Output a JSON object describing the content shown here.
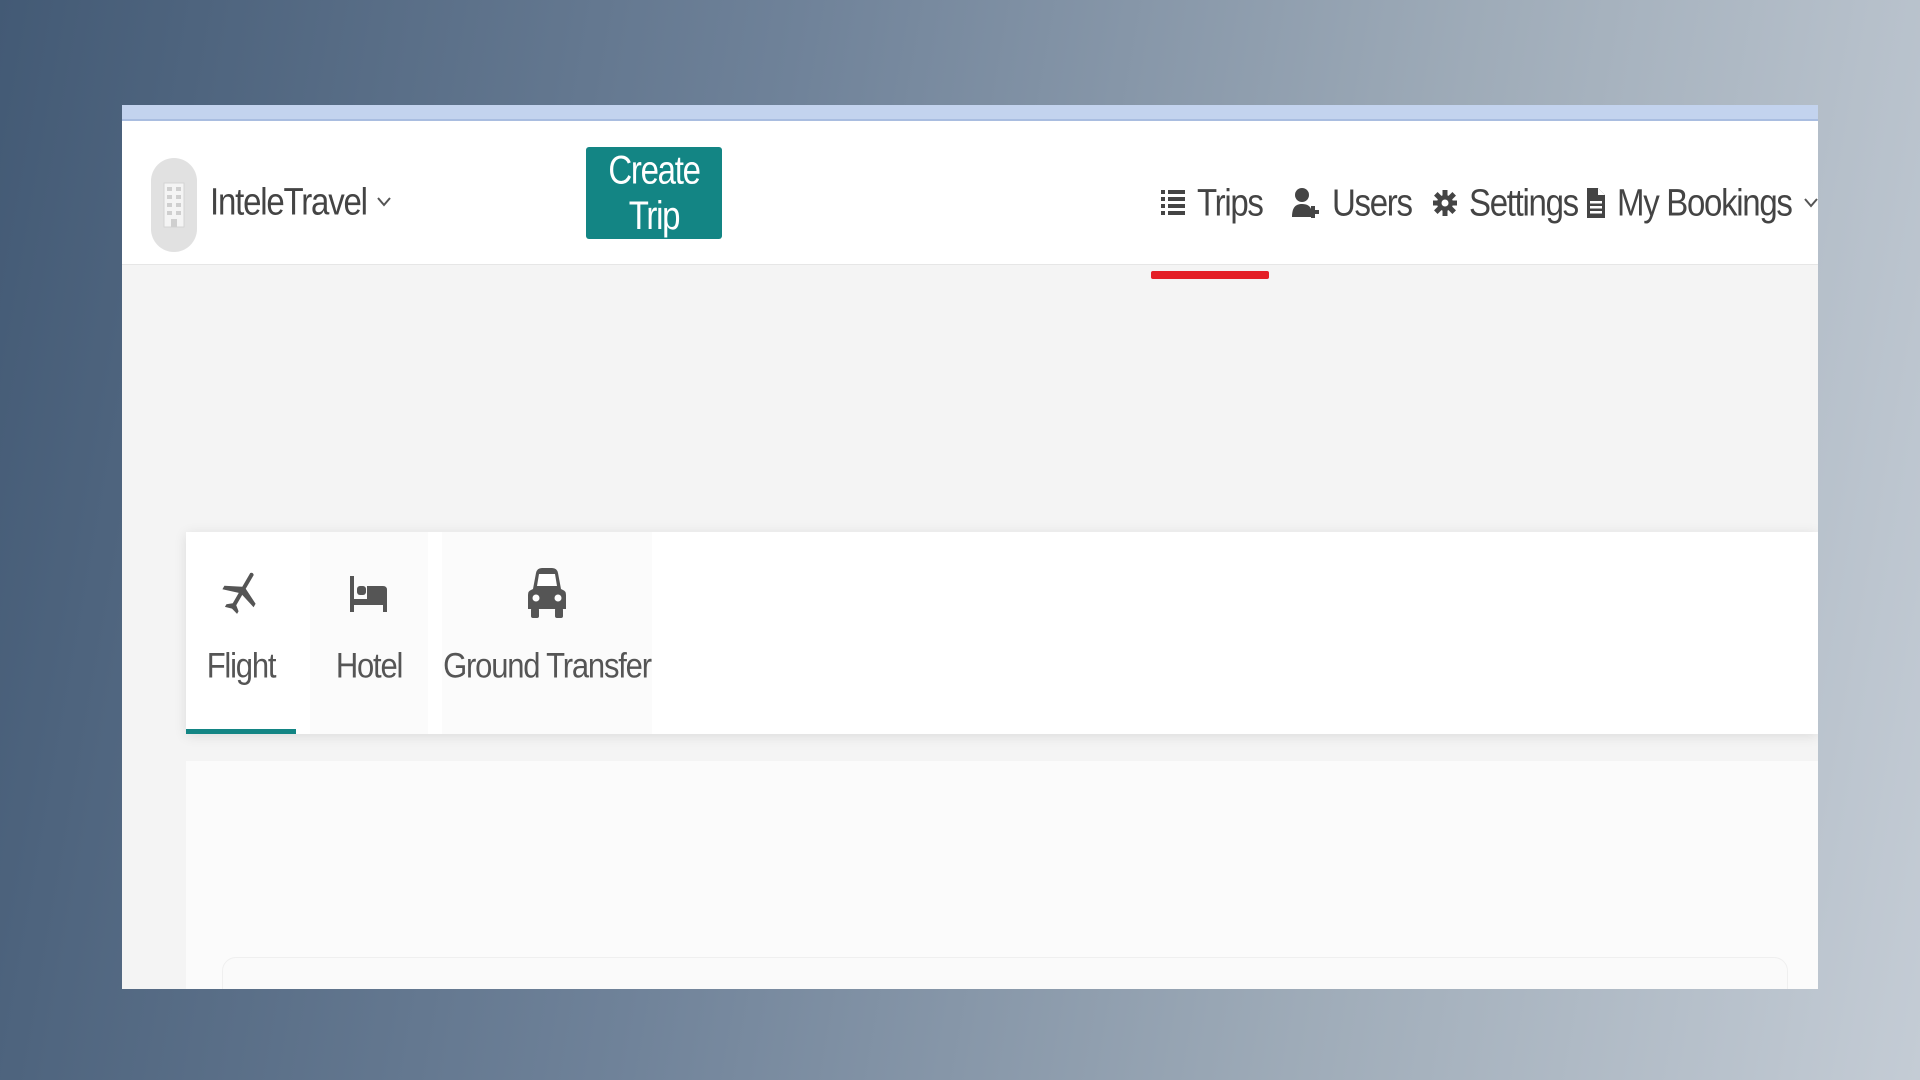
{
  "app": {
    "brand_name": "InteleTravel",
    "create_trip_label": "Create Trip",
    "accent_color": "#138584",
    "active_indicator_color": "#e41f26"
  },
  "nav": {
    "items": [
      {
        "label": "Trips",
        "icon": "list-icon",
        "active": true
      },
      {
        "label": "Users",
        "icon": "user-plus-icon",
        "active": false
      },
      {
        "label": "Settings",
        "icon": "gear-icon",
        "active": false
      },
      {
        "label": "My Bookings",
        "icon": "document-icon",
        "active": false,
        "has_dropdown": true
      }
    ]
  },
  "booking_tabs": {
    "items": [
      {
        "label": "Flight",
        "icon": "plane-icon",
        "active": true
      },
      {
        "label": "Hotel",
        "icon": "bed-icon",
        "active": false
      },
      {
        "label": "Ground Transfer",
        "icon": "car-icon",
        "active": false
      }
    ]
  }
}
